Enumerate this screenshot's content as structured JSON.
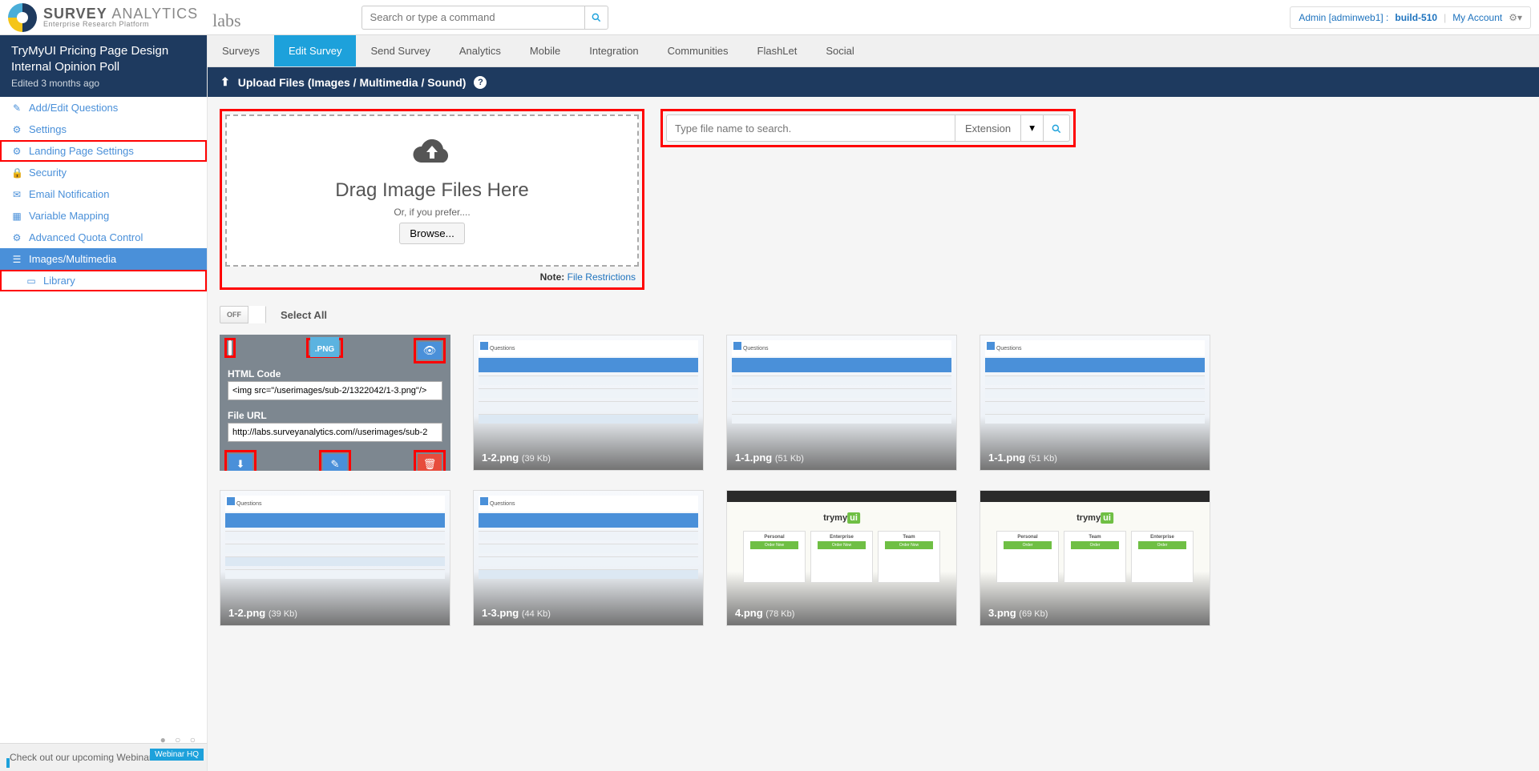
{
  "brand": {
    "name_main": "SURVEY",
    "name_sub": "ANALYTICS",
    "tagline": "Enterprise Research Platform",
    "labs": "labs"
  },
  "header_search": {
    "placeholder": "Search or type a command"
  },
  "header_right": {
    "admin": "Admin [adminweb1] :",
    "build": "build-510",
    "myaccount": "My Account"
  },
  "sidebar_head": {
    "title": "TryMyUI Pricing Page Design Internal Opinion Poll",
    "meta": "Edited 3 months ago"
  },
  "sidenav": {
    "add_edit": "Add/Edit Questions",
    "settings": "Settings",
    "landing": "Landing Page Settings",
    "security": "Security",
    "email": "Email Notification",
    "variable": "Variable Mapping",
    "quota": "Advanced Quota Control",
    "images": "Images/Multimedia",
    "library": "Library"
  },
  "topnav": [
    "Surveys",
    "Edit Survey",
    "Send Survey",
    "Analytics",
    "Mobile",
    "Integration",
    "Communities",
    "FlashLet",
    "Social"
  ],
  "banner": "Upload Files (Images / Multimedia / Sound)",
  "dropzone": {
    "big": "Drag Image Files Here",
    "small": "Or, if you prefer....",
    "browse": "Browse...",
    "note_label": "Note:",
    "note_link": "File Restrictions"
  },
  "file_search": {
    "placeholder": "Type file name to search.",
    "ext": "Extension"
  },
  "controls": {
    "toggle": "OFF",
    "select_all": "Select All"
  },
  "expanded": {
    "html_label": "HTML Code",
    "html_value": "<img src=\"/userimages/sub-2/1322042/1-3.png\"/>",
    "url_label": "File URL",
    "url_value": "http://labs.surveyanalytics.com//userimages/sub-2",
    "badge": ".PNG"
  },
  "files": [
    {
      "name": "1-2.png",
      "size": "(39 Kb)"
    },
    {
      "name": "1-1.png",
      "size": "(51 Kb)"
    },
    {
      "name": "1-1.png",
      "size": "(51 Kb)"
    },
    {
      "name": "1-2.png",
      "size": "(39 Kb)"
    },
    {
      "name": "1-3.png",
      "size": "(44 Kb)"
    },
    {
      "name": "4.png",
      "size": "(78 Kb)"
    },
    {
      "name": "3.png",
      "size": "(69 Kb)"
    }
  ],
  "promo": {
    "text": "Check out our upcoming Webinar!",
    "tag": "Webinar HQ"
  }
}
